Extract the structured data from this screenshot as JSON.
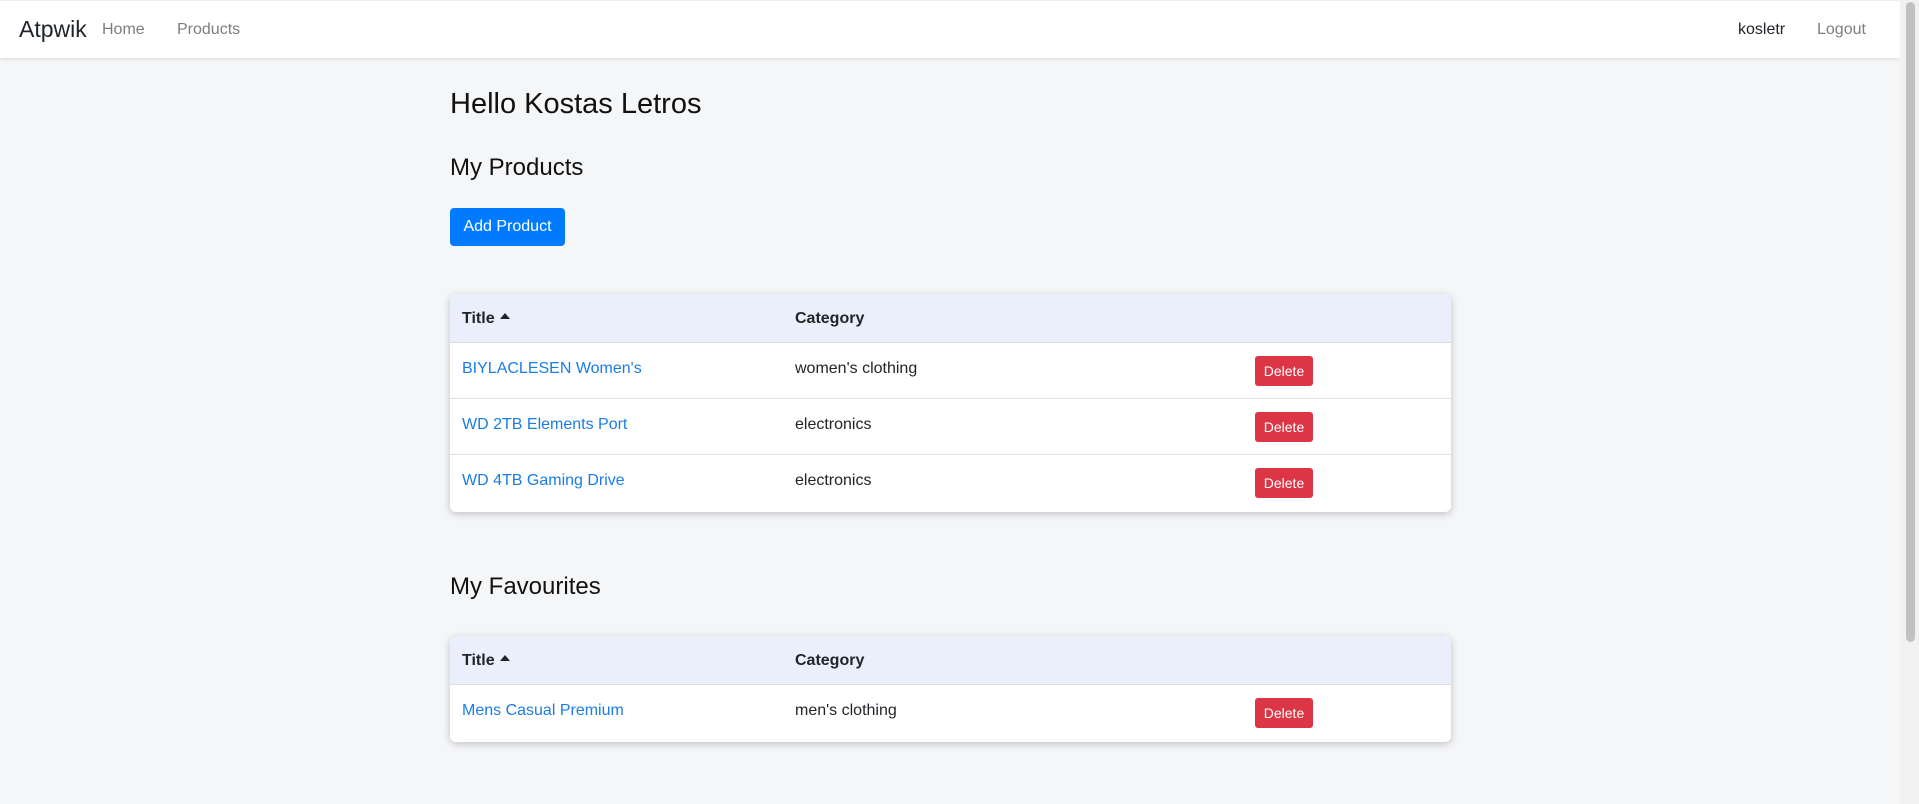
{
  "navbar": {
    "brand": "Atpwik",
    "links": [
      "Home",
      "Products"
    ],
    "user": "kosletr",
    "logout": "Logout"
  },
  "greeting": "Hello Kostas Letros",
  "my_products": {
    "heading": "My Products",
    "add_button": "Add Product",
    "columns": {
      "title": "Title",
      "category": "Category"
    },
    "rows": [
      {
        "title": "BIYLACLESEN Women's",
        "category": "women's clothing",
        "action": "Delete"
      },
      {
        "title": "WD 2TB Elements Port",
        "category": "electronics",
        "action": "Delete"
      },
      {
        "title": "WD 4TB Gaming Drive",
        "category": "electronics",
        "action": "Delete"
      }
    ]
  },
  "my_favourites": {
    "heading": "My Favourites",
    "columns": {
      "title": "Title",
      "category": "Category"
    },
    "rows": [
      {
        "title": "Mens Casual Premium",
        "category": "men's clothing",
        "action": "Delete"
      }
    ]
  },
  "colors": {
    "primary": "#007bff",
    "danger": "#dc3545",
    "link": "#1a7de6",
    "table_header": "#eaeffb",
    "background": "#f5f6f8"
  }
}
